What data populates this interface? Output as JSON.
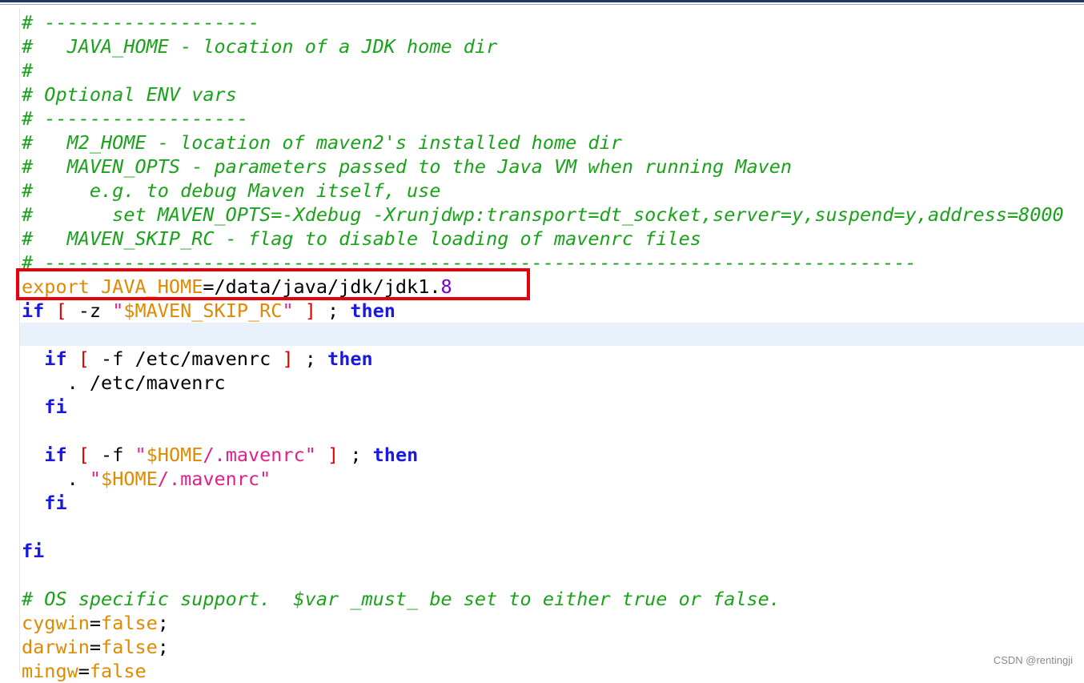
{
  "lines": [
    {
      "t": [
        {
          "s": "cm",
          "v": "# -------------------"
        }
      ]
    },
    {
      "t": [
        {
          "s": "cm",
          "v": "#   JAVA_HOME - location of a JDK home dir"
        }
      ]
    },
    {
      "t": [
        {
          "s": "cm",
          "v": "#"
        }
      ]
    },
    {
      "t": [
        {
          "s": "cm",
          "v": "# Optional ENV vars"
        }
      ]
    },
    {
      "t": [
        {
          "s": "cm",
          "v": "# ------------------"
        }
      ]
    },
    {
      "t": [
        {
          "s": "cm",
          "v": "#   M2_HOME - location of maven2's installed home dir"
        }
      ]
    },
    {
      "t": [
        {
          "s": "cm",
          "v": "#   MAVEN_OPTS - parameters passed to the Java VM when running Maven"
        }
      ]
    },
    {
      "t": [
        {
          "s": "cm",
          "v": "#     e.g. to debug Maven itself, use"
        }
      ]
    },
    {
      "t": [
        {
          "s": "cm",
          "v": "#       set MAVEN_OPTS=-Xdebug -Xrunjdwp:transport=dt_socket,server=y,suspend=y,address=8000"
        }
      ]
    },
    {
      "t": [
        {
          "s": "cm",
          "v": "#   MAVEN_SKIP_RC - flag to disable loading of mavenrc files"
        }
      ]
    },
    {
      "t": [
        {
          "s": "cm",
          "v": "# -----------------------------------------------------------------------------"
        }
      ]
    },
    {
      "t": [
        {
          "s": "vr",
          "v": "export JAVA_HOME"
        },
        {
          "s": "pl",
          "v": "=/data/java/jdk/jdk1."
        },
        {
          "s": "nm",
          "v": "8"
        }
      ]
    },
    {
      "t": [
        {
          "s": "kw",
          "v": "if"
        },
        {
          "s": "pl",
          "v": " "
        },
        {
          "s": "br",
          "v": "["
        },
        {
          "s": "pl",
          "v": " -z "
        },
        {
          "s": "pk",
          "v": "\""
        },
        {
          "s": "vr",
          "v": "$MAVEN_SKIP_RC"
        },
        {
          "s": "pk",
          "v": "\""
        },
        {
          "s": "pl",
          "v": " "
        },
        {
          "s": "br",
          "v": "]"
        },
        {
          "s": "pl",
          "v": " ; "
        },
        {
          "s": "kw",
          "v": "then"
        }
      ]
    },
    {
      "t": []
    },
    {
      "t": [
        {
          "s": "pl",
          "v": "  "
        },
        {
          "s": "kw",
          "v": "if"
        },
        {
          "s": "pl",
          "v": " "
        },
        {
          "s": "br",
          "v": "["
        },
        {
          "s": "pl",
          "v": " -f /etc/mavenrc "
        },
        {
          "s": "br",
          "v": "]"
        },
        {
          "s": "pl",
          "v": " ; "
        },
        {
          "s": "kw",
          "v": "then"
        }
      ]
    },
    {
      "t": [
        {
          "s": "pl",
          "v": "    . /etc/mavenrc"
        }
      ]
    },
    {
      "t": [
        {
          "s": "pl",
          "v": "  "
        },
        {
          "s": "kw",
          "v": "fi"
        }
      ]
    },
    {
      "t": []
    },
    {
      "t": [
        {
          "s": "pl",
          "v": "  "
        },
        {
          "s": "kw",
          "v": "if"
        },
        {
          "s": "pl",
          "v": " "
        },
        {
          "s": "br",
          "v": "["
        },
        {
          "s": "pl",
          "v": " -f "
        },
        {
          "s": "pk",
          "v": "\""
        },
        {
          "s": "vr",
          "v": "$HOME"
        },
        {
          "s": "pk",
          "v": "/.mavenrc\""
        },
        {
          "s": "pl",
          "v": " "
        },
        {
          "s": "br",
          "v": "]"
        },
        {
          "s": "pl",
          "v": " ; "
        },
        {
          "s": "kw",
          "v": "then"
        }
      ]
    },
    {
      "t": [
        {
          "s": "pl",
          "v": "    . "
        },
        {
          "s": "pk",
          "v": "\""
        },
        {
          "s": "vr",
          "v": "$HOME"
        },
        {
          "s": "pk",
          "v": "/.mavenrc\""
        }
      ]
    },
    {
      "t": [
        {
          "s": "pl",
          "v": "  "
        },
        {
          "s": "kw",
          "v": "fi"
        }
      ]
    },
    {
      "t": []
    },
    {
      "t": [
        {
          "s": "kw",
          "v": "fi"
        }
      ]
    },
    {
      "t": []
    },
    {
      "t": [
        {
          "s": "cm",
          "v": "# OS specific support.  $var _must_ be set to either true or false."
        }
      ]
    },
    {
      "t": [
        {
          "s": "vr",
          "v": "cygwin"
        },
        {
          "s": "pl",
          "v": "="
        },
        {
          "s": "vr",
          "v": "false"
        },
        {
          "s": "pl",
          "v": ";"
        }
      ]
    },
    {
      "t": [
        {
          "s": "vr",
          "v": "darwin"
        },
        {
          "s": "pl",
          "v": "="
        },
        {
          "s": "vr",
          "v": "false"
        },
        {
          "s": "pl",
          "v": ";"
        }
      ]
    },
    {
      "t": [
        {
          "s": "vr",
          "v": "mingw"
        },
        {
          "s": "pl",
          "v": "="
        },
        {
          "s": "vr",
          "v": "false"
        }
      ]
    }
  ],
  "watermark": "CSDN @rentingji",
  "colors": {
    "comment": "#1aa31a",
    "keyword": "#1a1adf",
    "variable": "#df8a00",
    "bracket": "#e00000",
    "string": "#e0208a",
    "number": "#7a00c8",
    "highlight_box": "#e8000a",
    "current_line": "#e9f1fb"
  }
}
